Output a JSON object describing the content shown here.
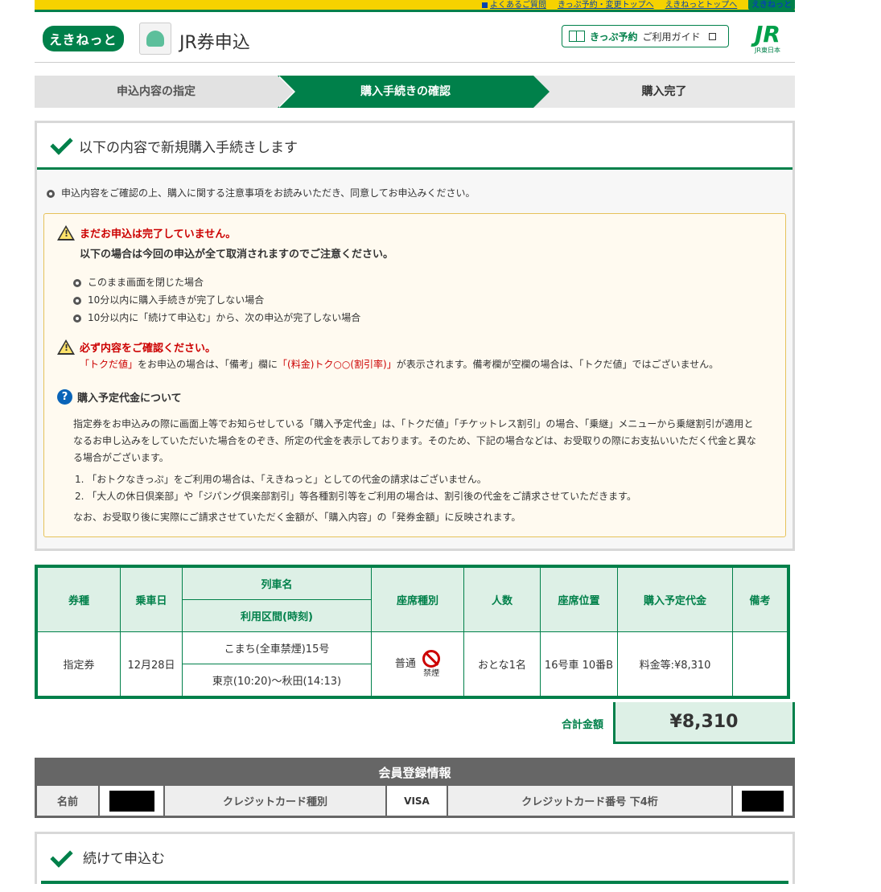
{
  "toplinks": {
    "faq": "よくあるご質問",
    "ticket_top": "きっぷ予約・変更トップへ",
    "ekinet_top": "えきねっとトップへ",
    "mini_logo": "えきねっと"
  },
  "header": {
    "logo": "えきねっと",
    "title": "JR券申込",
    "guide_bold": "きっぷ予約",
    "guide_rest": "ご利用ガイド",
    "jr_logo": "JR",
    "jr_sub": "JR東日本"
  },
  "steps": [
    "申込内容の指定",
    "購入手続きの確認",
    "購入完了"
  ],
  "panel": {
    "title": "以下の内容で新規購入手続きします",
    "intro": "申込内容をご確認の上、購入に関する注意事項をお読みいただき、同意してお申込みください。",
    "warn1_title": "まだお申込は完了していません。",
    "warn1_sub": "以下の場合は今回の申込が全て取消されますのでご注意ください。",
    "warn1_items": [
      "このまま画面を閉じた場合",
      "10分以内に購入手続きが完了しない場合",
      "10分以内に「続けて申込む」から、次の申込が完了しない場合"
    ],
    "warn2_title": "必ず内容をご確認ください。",
    "warn2_red1": "「トクだ値」",
    "warn2_t1": "をお申込の場合は、「備考」欄に",
    "warn2_red2": "「(料金)トク○○(割引率)」",
    "warn2_t2": "が表示されます。備考欄が空欄の場合は、「トクだ値」ではございません。",
    "q_title": "購入予定代金について",
    "q_para": "指定券をお申込みの際に画面上等でお知らせしている「購入予定代金」は、「トクだ値」「チケットレス割引」の場合、「乗継」メニューから乗継割引が適用となるお申し込みをしていただいた場合をのぞき、所定の代金を表示しております。そのため、下記の場合などは、お受取りの際にお支払いいただく代金と異なる場合がございます。",
    "q_list": [
      "1. 「おトクなきっぷ」をご利用の場合は、「えきねっと」としての代金の請求はございません。",
      "2. 「大人の休日倶楽部」や「ジパング倶楽部割引」等各種割引等をご利用の場合は、割引後の代金をご請求させていただきます。"
    ],
    "q_foot": "なお、お受取り後に実際にご請求させていただく金額が、「購入内容」の「発券金額」に反映されます。"
  },
  "ticket": {
    "headers": {
      "type": "券種",
      "date": "乗車日",
      "train": "列車名",
      "section": "利用区間(時刻)",
      "seat_type": "座席種別",
      "people": "人数",
      "seat_pos": "座席位置",
      "price": "購入予定代金",
      "note": "備考"
    },
    "row": {
      "type": "指定券",
      "date": "12月28日",
      "train": "こまち(全車禁煙)15号",
      "section": "東京(10:20)～秋田(14:13)",
      "seat_type": "普通",
      "no_smoking": "禁煙",
      "people": "おとな1名",
      "seat_pos": "16号車 10番B",
      "price": "料金等:¥8,310",
      "note": ""
    },
    "total_label": "合計金額",
    "total_value": "¥8,310"
  },
  "member": {
    "title": "会員登録情報",
    "name_label": "名前",
    "card_type_label": "クレジットカード種別",
    "card_type": "VISA",
    "card_last4_label": "クレジットカード番号 下4桁"
  },
  "panel2": {
    "title": "続けて申込む"
  }
}
